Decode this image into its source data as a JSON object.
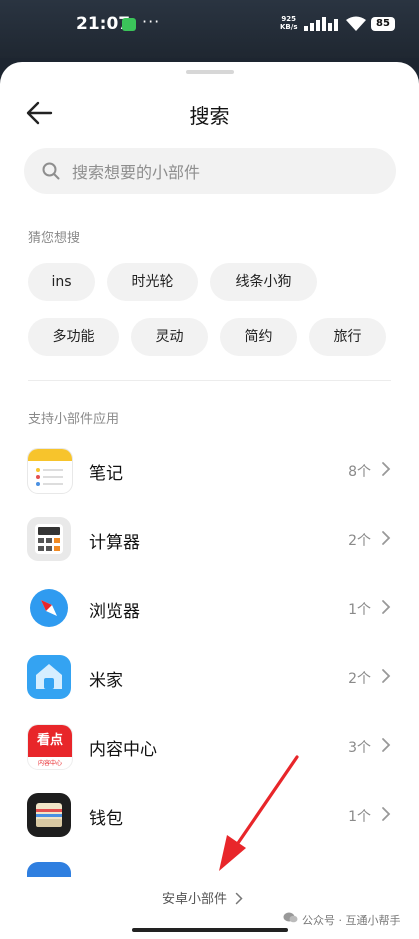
{
  "status_bar": {
    "time": "21:07",
    "dots": "···",
    "net_speed_value": "925",
    "net_speed_unit": "KB/s",
    "battery": "85"
  },
  "header": {
    "title": "搜索"
  },
  "search": {
    "placeholder": "搜索想要的小部件"
  },
  "suggestions": {
    "label": "猜您想搜",
    "chips": [
      "ins",
      "时光轮",
      "线条小狗",
      "多功能",
      "灵动",
      "简约",
      "旅行"
    ]
  },
  "apps": {
    "label": "支持小部件应用",
    "items": [
      {
        "name": "笔记",
        "count": "8个",
        "icon": "notes-icon"
      },
      {
        "name": "计算器",
        "count": "2个",
        "icon": "calculator-icon"
      },
      {
        "name": "浏览器",
        "count": "1个",
        "icon": "browser-compass-icon"
      },
      {
        "name": "米家",
        "count": "2个",
        "icon": "mi-home-icon"
      },
      {
        "name": "内容中心",
        "count": "3个",
        "icon": "content-center-icon"
      },
      {
        "name": "钱包",
        "count": "1个",
        "icon": "wallet-icon"
      }
    ],
    "content_icon_text": "看点",
    "content_icon_sub": "内容中心"
  },
  "footer": {
    "link_label": "安卓小部件",
    "watermark": "公众号 · 互通小帮手"
  },
  "colors": {
    "accent_red": "#e8262a",
    "chip_bg": "#f2f2f2"
  }
}
